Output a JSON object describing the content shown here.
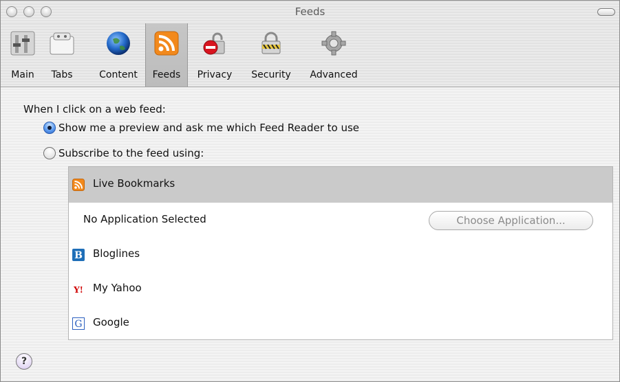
{
  "window": {
    "title": "Feeds"
  },
  "toolbar": {
    "items": [
      {
        "label": "Main",
        "icon": "switch-icon"
      },
      {
        "label": "Tabs",
        "icon": "tabs-icon"
      },
      {
        "label": "Content",
        "icon": "globe-icon"
      },
      {
        "label": "Feeds",
        "icon": "rss-icon",
        "selected": true
      },
      {
        "label": "Privacy",
        "icon": "privacy-lock-icon"
      },
      {
        "label": "Security",
        "icon": "padlock-icon"
      },
      {
        "label": "Advanced",
        "icon": "gear-icon"
      }
    ]
  },
  "content": {
    "heading": "When I click on a web feed:",
    "radio_options": [
      {
        "label": "Show me a preview and ask me which Feed Reader to use",
        "checked": true
      },
      {
        "label": "Subscribe to the feed using:",
        "checked": false
      }
    ],
    "readers": [
      {
        "label": "Live Bookmarks",
        "icon": "rss-icon",
        "selected": true
      },
      {
        "label": "No Application Selected",
        "icon": "",
        "button": "Choose Application..."
      },
      {
        "label": "Bloglines",
        "icon": "bloglines-icon"
      },
      {
        "label": "My Yahoo",
        "icon": "yahoo-icon"
      },
      {
        "label": "Google",
        "icon": "google-icon"
      }
    ]
  },
  "help": {
    "glyph": "?"
  },
  "colors": {
    "accent": "#f2891c",
    "selection": "#cacaca",
    "radio_blue": "#2c62c2"
  }
}
